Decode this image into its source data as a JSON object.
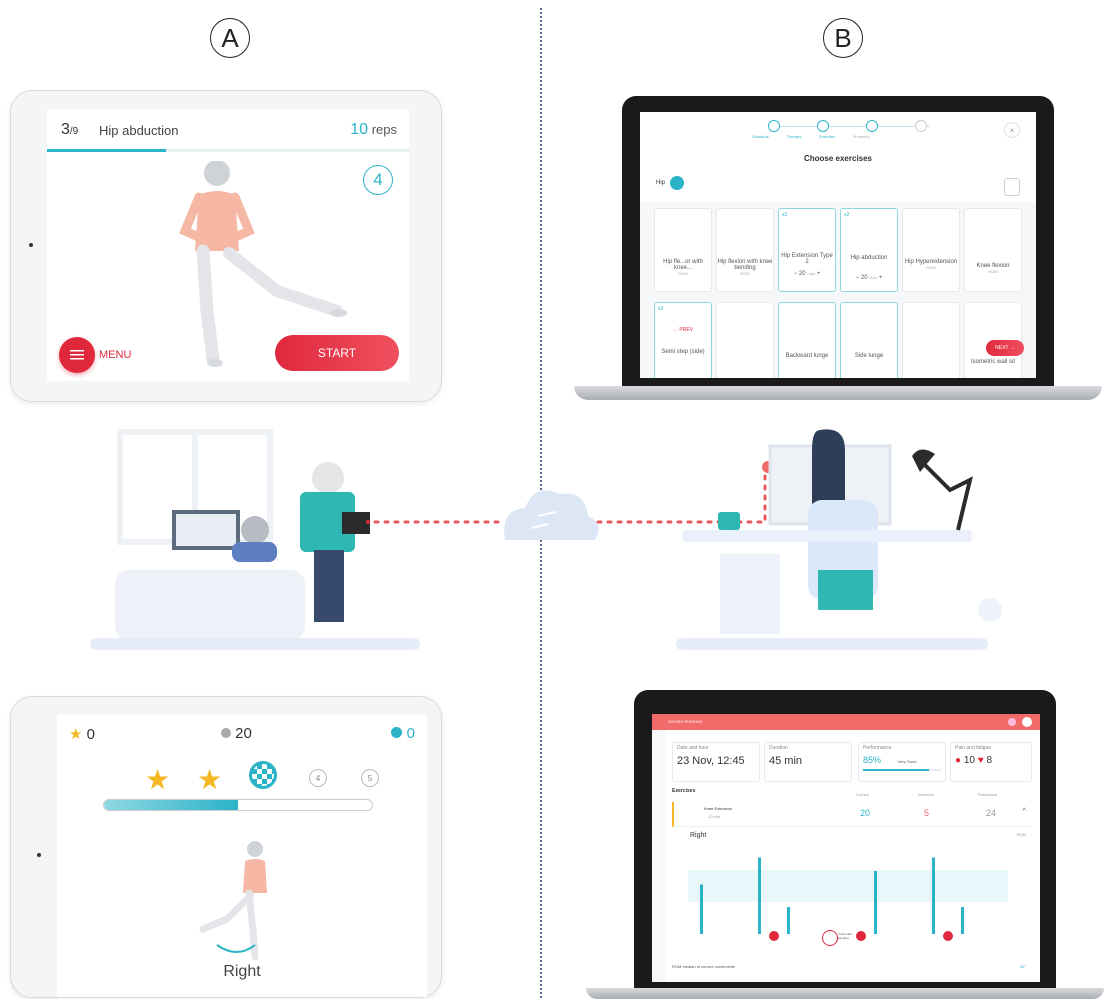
{
  "labels": {
    "a": "A",
    "b": "B"
  },
  "tablet_top": {
    "progress_current": "3",
    "progress_total": "/9",
    "exercise": "Hip abduction",
    "reps_value": "10",
    "reps_unit": "reps",
    "countdown": "4",
    "menu_label": "MENU",
    "start_label": "START",
    "progress_fraction": 0.33
  },
  "tablet_bottom": {
    "stars": "0",
    "coins": "20",
    "checks": "0",
    "level_4": "4",
    "level_5": "5",
    "side": "Right",
    "progress_fraction": 0.5
  },
  "laptop_top": {
    "steps": [
      "Schedule",
      "Therapy",
      "Exercise",
      "Summary"
    ],
    "title": "Choose exercises",
    "category": "Hip",
    "row1": [
      {
        "name": "Hip fle...or with knee...",
        "sub": "ROM"
      },
      {
        "name": "Hip flexion with knee bending",
        "sub": "ROM"
      },
      {
        "name": "Hip Extension Type 2",
        "sub": "ROM",
        "count": "20",
        "unit": "reps"
      },
      {
        "name": "Hip abduction",
        "sub": "ROM",
        "count": "20",
        "unit": "reps"
      },
      {
        "name": "Hip Hyperextension",
        "sub": "ROM"
      },
      {
        "name": "Knee flexion",
        "sub": "ROM"
      }
    ],
    "row2": [
      {
        "name": "Semi step (side)"
      },
      {
        "name": ""
      },
      {
        "name": "Backward lunge"
      },
      {
        "name": "Side lunge"
      },
      {
        "name": ""
      },
      {
        "name": "Isometric wall sit"
      }
    ],
    "prev_label": "PREV",
    "next_label": "NEXT",
    "minus": "−",
    "plus": "+",
    "x2": "x2"
  },
  "laptop_bottom": {
    "brand": "SWORD PHOENIX",
    "date_label": "Date and hour",
    "date_value": "23 Nov, 12:45",
    "duration_label": "Duration",
    "duration_value": "45 min",
    "performance_label": "Performance",
    "performance_value": "85%",
    "performance_text": "Very Good",
    "pain_label": "Pain and fatigue",
    "pain_value": "10",
    "fatigue_value": "8",
    "exercises_label": "Exercises",
    "col_correct": "Correct",
    "col_incorrect": "Incorrect",
    "col_prescribed": "Prescribed",
    "exercise_name": "Knee Extension",
    "exercise_time": "10 min",
    "correct": "20",
    "incorrect": "5",
    "prescribed": "24",
    "side": "Right",
    "rom_label": "ROM",
    "tooltip": "Trunk side bending",
    "footer": "ROM median of correct movements",
    "footer_value": "32°",
    "bar_heights": [
      0.55,
      0,
      0.85,
      0.3,
      0,
      0,
      0.7,
      0,
      0.85,
      0.3
    ],
    "error_marks": [
      2,
      5,
      8
    ],
    "performance_fraction": 0.85
  },
  "colors": {
    "teal": "#2bb3c8",
    "red": "#e0283d",
    "navy": "#5b6a9a"
  }
}
